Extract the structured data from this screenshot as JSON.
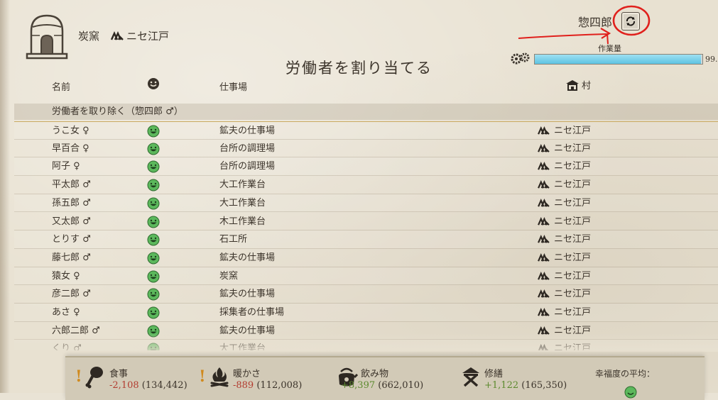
{
  "header": {
    "building_name": "炭窯",
    "village_name": "ニセ江戸",
    "worker_name": "惣四郎",
    "swap_icon": "swap-arrows-icon",
    "workload_label": "作業量",
    "workload_value": "99.",
    "workload_fraction": 0.99
  },
  "title": "労働者を割り当てる",
  "columns": {
    "name": "名前",
    "workplace": "仕事場",
    "village": "村"
  },
  "remove_row_label": "労働者を取り除く（惣四郎 ♂）",
  "rows": [
    {
      "name": "うこ女 ♀",
      "workplace": "鉱夫の仕事場",
      "village": "ニセ江戸"
    },
    {
      "name": "早百合 ♀",
      "workplace": "台所の調理場",
      "village": "ニセ江戸"
    },
    {
      "name": "阿子 ♀",
      "workplace": "台所の調理場",
      "village": "ニセ江戸"
    },
    {
      "name": "平太郎 ♂",
      "workplace": "大工作業台",
      "village": "ニセ江戸"
    },
    {
      "name": "孫五郎 ♂",
      "workplace": "大工作業台",
      "village": "ニセ江戸"
    },
    {
      "name": "又太郎 ♂",
      "workplace": "木工作業台",
      "village": "ニセ江戸"
    },
    {
      "name": "とりす ♂",
      "workplace": "石工所",
      "village": "ニセ江戸"
    },
    {
      "name": "藤七郎 ♂",
      "workplace": "鉱夫の仕事場",
      "village": "ニセ江戸"
    },
    {
      "name": "猿女 ♀",
      "workplace": "炭窯",
      "village": "ニセ江戸"
    },
    {
      "name": "彦二郎 ♂",
      "workplace": "鉱夫の仕事場",
      "village": "ニセ江戸"
    },
    {
      "name": "あさ ♀",
      "workplace": "採集者の仕事場",
      "village": "ニセ江戸"
    },
    {
      "name": "六郎二郎 ♂",
      "workplace": "鉱夫の仕事場",
      "village": "ニセ江戸"
    },
    {
      "name": "くり ♂",
      "workplace": "大工作業台",
      "village": "ニセ江戸"
    }
  ],
  "footer": {
    "food": {
      "label": "食事",
      "delta": "-2,108",
      "total": "(134,442)",
      "icon": "food-icon"
    },
    "warmth": {
      "label": "暖かさ",
      "delta": "-889",
      "total": "(112,008)",
      "icon": "fire-icon"
    },
    "drink": {
      "label": "飲み物",
      "delta": "+8,397",
      "total": "(662,010)",
      "icon": "kettle-icon"
    },
    "repair": {
      "label": "修繕",
      "delta": "+1,122",
      "total": "(165,350)",
      "icon": "repair-icon"
    },
    "happiness_label": "幸福度の平均："
  },
  "colors": {
    "negative": "#b23b2f",
    "positive": "#5c8a2e",
    "happy_face": "#5cb85c",
    "workload_bar": "#5ec3e2",
    "annotation": "#e0201c"
  }
}
